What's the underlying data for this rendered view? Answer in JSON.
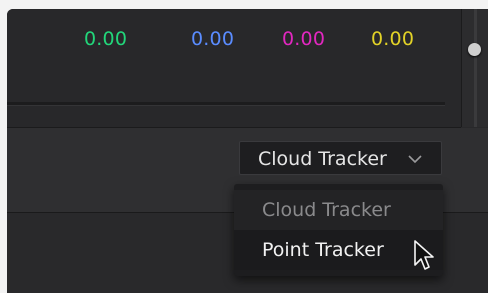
{
  "color_values": [
    {
      "text": "0.00",
      "color": "#22d67a"
    },
    {
      "text": "0.00",
      "color": "#5a8cff"
    },
    {
      "text": "0.00",
      "color": "#e227c0"
    },
    {
      "text": "0.00",
      "color": "#e2d227"
    }
  ],
  "tracker": {
    "selected": "Cloud Tracker",
    "options": [
      "Cloud Tracker",
      "Point Tracker"
    ],
    "highlighted": "Point Tracker"
  },
  "icons": {
    "dropdown": "chevron-down-icon",
    "cursor": "cursor-arrow-icon",
    "slider": "slider-knob"
  }
}
